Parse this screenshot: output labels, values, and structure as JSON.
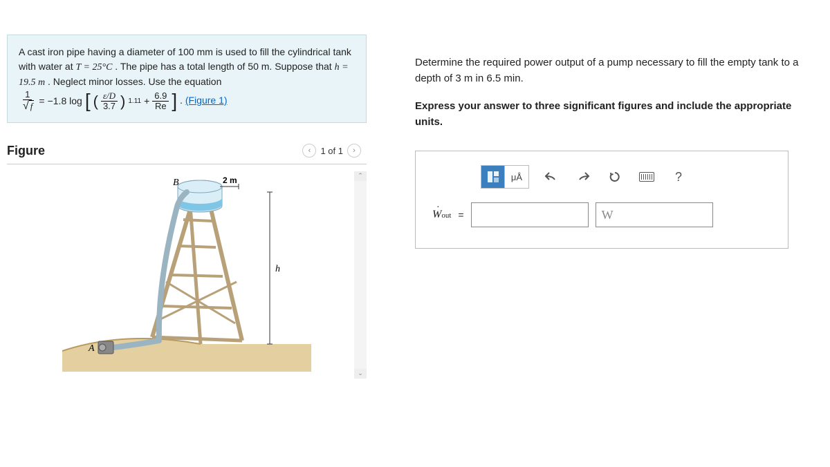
{
  "problem": {
    "text_before_T": "A cast iron pipe having a diameter of 100 mm is used to fill the cylindrical tank with water at ",
    "T_expr": "T = 25°C",
    "text_after_T": ". The pipe has a total length of 50 m. Suppose that ",
    "h_expr": "h = 19.5 m",
    "text_after_h": ". Neglect minor losses. Use the equation ",
    "eq": {
      "lhs_num": "1",
      "coef": "−1.8 log",
      "inner_num": "ε/D",
      "inner_den": "3.7",
      "exp": "1.11",
      "plus_num": "6.9",
      "plus_den": "Re"
    },
    "figure_link": "(Figure 1)",
    "dot": "."
  },
  "figure": {
    "heading": "Figure",
    "pager": "1 of 1",
    "labels": {
      "A": "A",
      "B": "B",
      "dim": "2 m",
      "h": "h"
    }
  },
  "question": {
    "prompt": "Determine the required power output of a pump necessary to fill the empty tank to a depth of 3 m in 6.5 min.",
    "instruction": "Express your answer to three significant figures and include the appropriate units."
  },
  "answer": {
    "toolbar": {
      "units": "μÅ",
      "help": "?"
    },
    "label_W": "W",
    "label_sub": "out",
    "equals": "=",
    "unit_placeholder": "W"
  }
}
